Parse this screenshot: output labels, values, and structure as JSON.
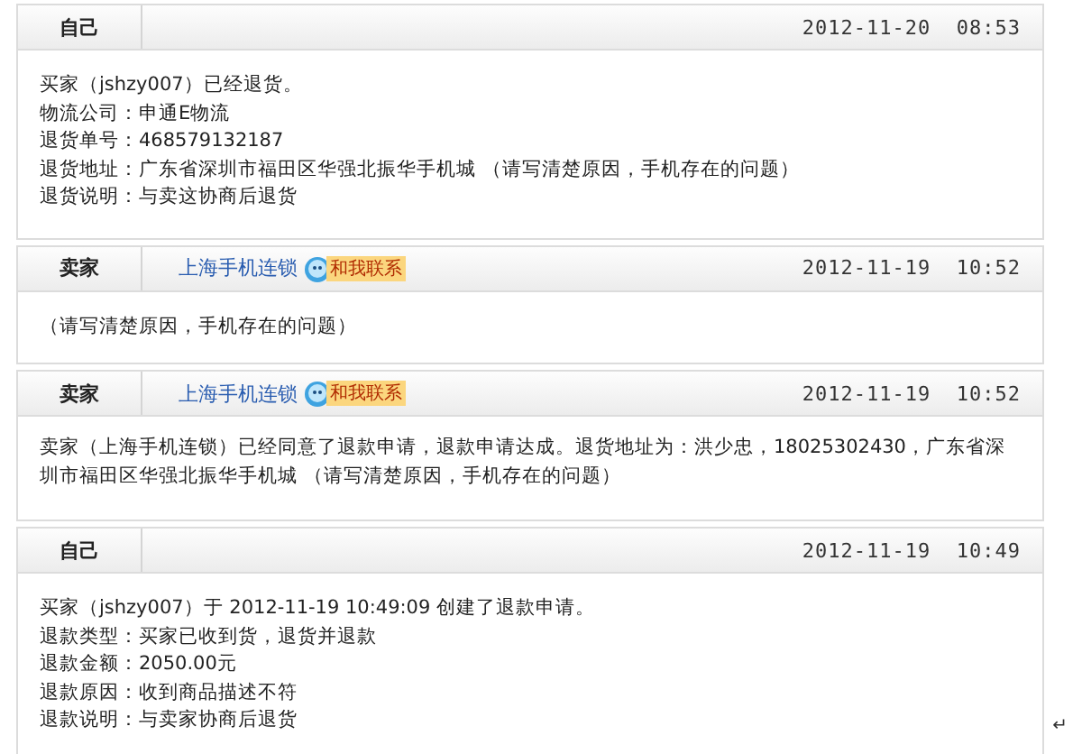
{
  "messages": [
    {
      "role": "自己",
      "time": "2012-11-20  08:53",
      "lines": [
        "买家（jshzy007）已经退货。",
        "物流公司：申通E物流",
        "退货单号：468579132187",
        "退货地址：广东省深圳市福田区华强北振华手机城 （请写清楚原因，手机存在的问题）",
        "退货说明：与卖这协商后退货"
      ]
    },
    {
      "role": "卖家",
      "shop": "上海手机连锁",
      "contact": "和我联系",
      "time": "2012-11-19  10:52",
      "lines": [
        "（请写清楚原因，手机存在的问题）"
      ]
    },
    {
      "role": "卖家",
      "shop": "上海手机连锁",
      "contact": "和我联系",
      "time": "2012-11-19  10:52",
      "lines": [
        "卖家（上海手机连锁）已经同意了退款申请，退款申请达成。退货地址为：洪少忠，18025302430，广东省深圳市福田区华强北振华手机城 （请写清楚原因，手机存在的问题）"
      ]
    },
    {
      "role": "自己",
      "time": "2012-11-19  10:49",
      "lines": [
        "买家（jshzy007）于 2012-11-19 10:49:09 创建了退款申请。",
        "退款类型：买家已收到货，退货并退款",
        "退款金额：2050.00元",
        "退款原因：收到商品描述不符",
        "退款说明：与卖家协商后退货"
      ]
    }
  ],
  "end_mark": "↵"
}
